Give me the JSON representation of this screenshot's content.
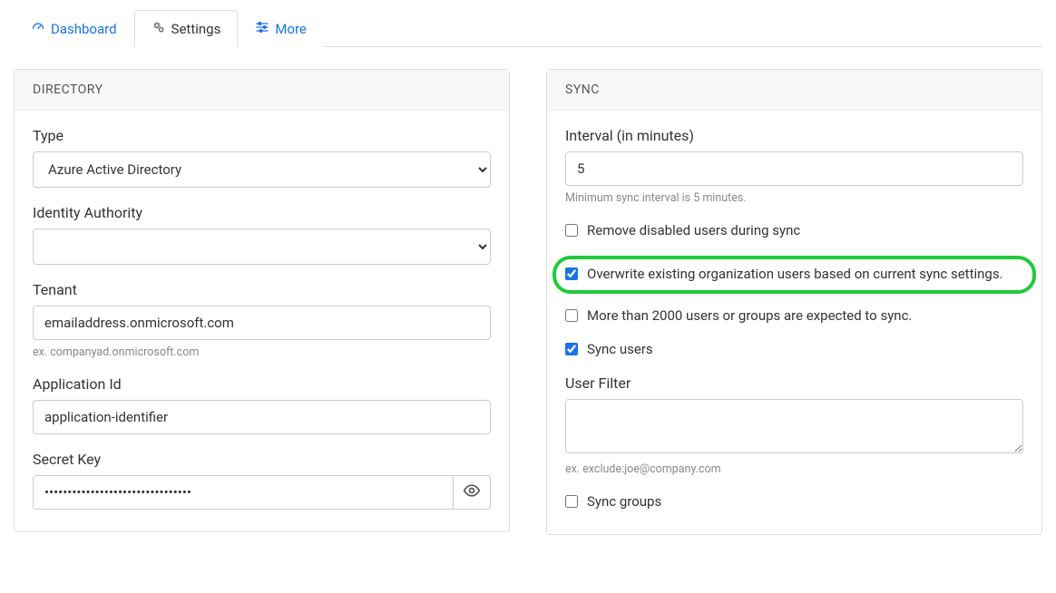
{
  "tabs": {
    "dashboard": "Dashboard",
    "settings": "Settings",
    "more": "More"
  },
  "directory": {
    "title": "DIRECTORY",
    "type_label": "Type",
    "type_value": "Azure Active Directory",
    "identity_authority_label": "Identity Authority",
    "identity_authority_value": "",
    "tenant_label": "Tenant",
    "tenant_value": "emailaddress.onmicrosoft.com",
    "tenant_hint": "ex. companyad.onmicrosoft.com",
    "appid_label": "Application Id",
    "appid_value": "application-identifier",
    "secret_label": "Secret Key",
    "secret_value": "••••••••••••••••••••••••••••••••"
  },
  "sync": {
    "title": "SYNC",
    "interval_label": "Interval (in minutes)",
    "interval_value": "5",
    "interval_hint": "Minimum sync interval is 5 minutes.",
    "remove_disabled_label": "Remove disabled users during sync",
    "remove_disabled_checked": false,
    "overwrite_label": "Overwrite existing organization users based on current sync settings.",
    "overwrite_checked": true,
    "more_than_2000_label": "More than 2000 users or groups are expected to sync.",
    "more_than_2000_checked": false,
    "sync_users_label": "Sync users",
    "sync_users_checked": true,
    "user_filter_label": "User Filter",
    "user_filter_value": "",
    "user_filter_hint": "ex. exclude:joe@company.com",
    "sync_groups_label": "Sync groups",
    "sync_groups_checked": false
  }
}
